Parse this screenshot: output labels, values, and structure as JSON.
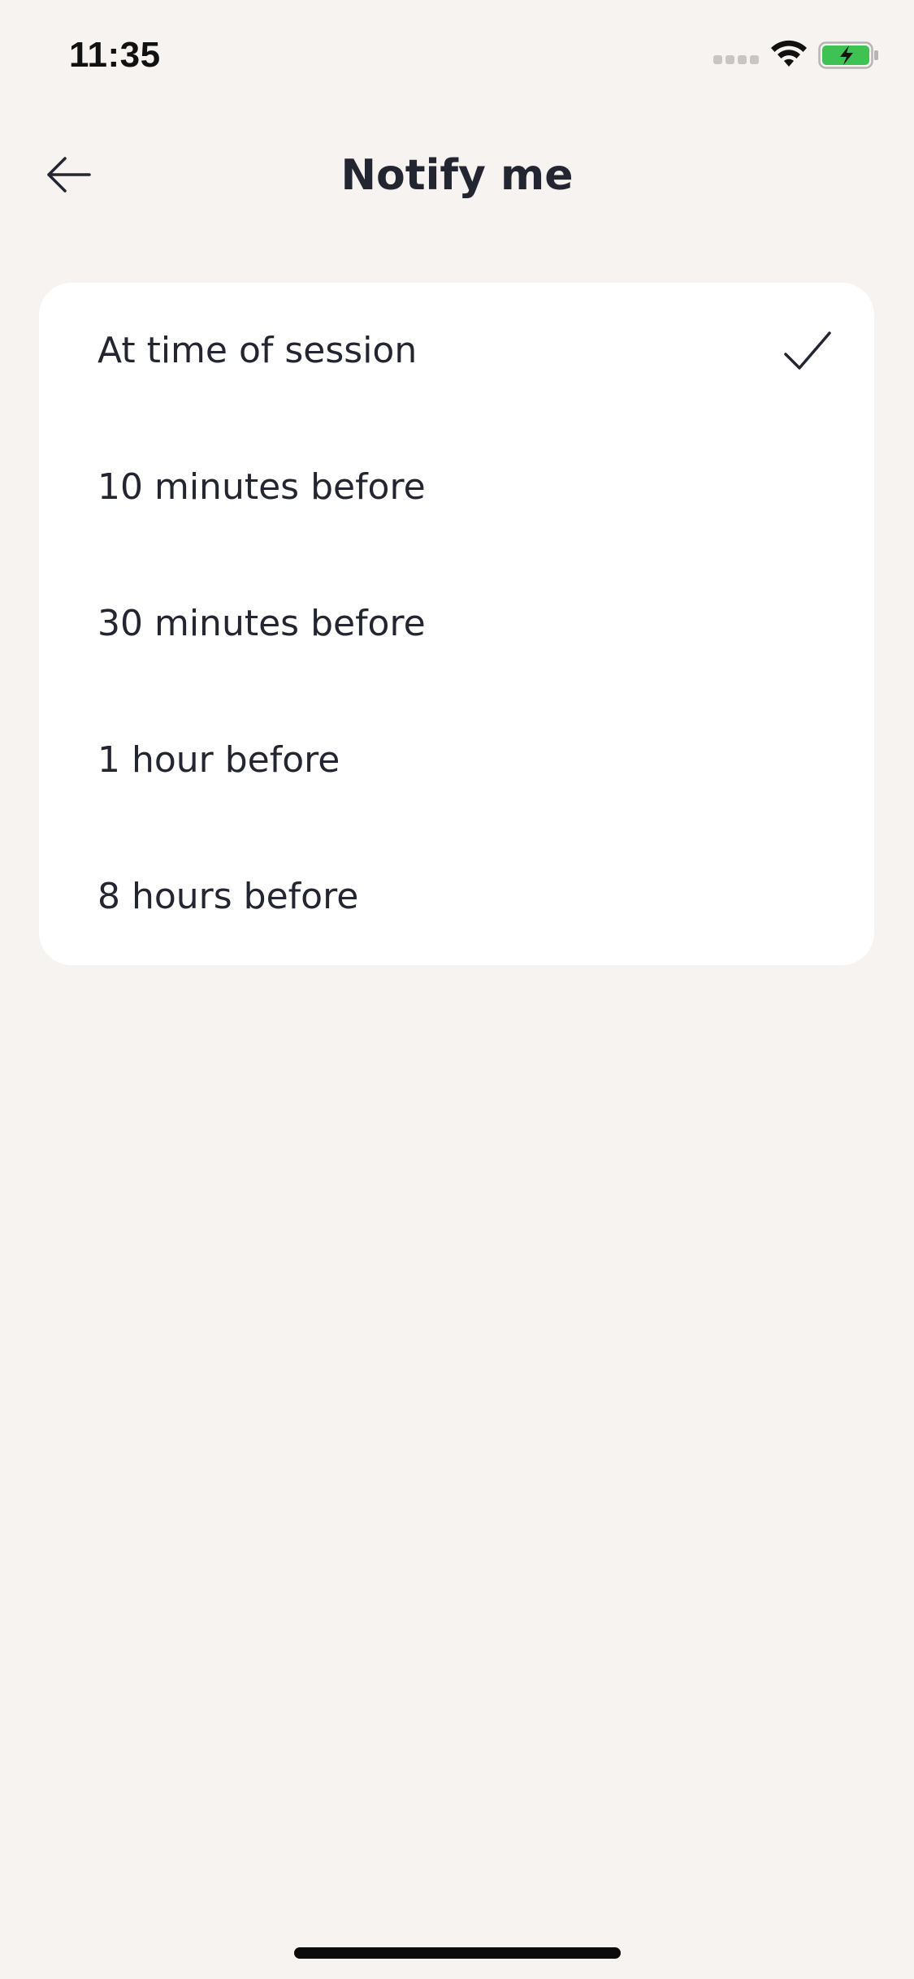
{
  "status_bar": {
    "time": "11:35",
    "icons": [
      "cellular-signal-icon",
      "wifi-icon",
      "battery-charging-icon"
    ],
    "battery_color": "#3ec254"
  },
  "header": {
    "title": "Notify me",
    "back_icon": "arrow-left-icon"
  },
  "options": {
    "items": [
      {
        "label": "At time of session",
        "selected": true
      },
      {
        "label": "10 minutes before",
        "selected": false
      },
      {
        "label": "30 minutes before",
        "selected": false
      },
      {
        "label": "1 hour before",
        "selected": false
      },
      {
        "label": "8 hours before",
        "selected": false
      }
    ],
    "selected_icon": "checkmark-icon"
  },
  "colors": {
    "background": "#f6f3f0",
    "card": "#ffffff",
    "text": "#232530"
  }
}
